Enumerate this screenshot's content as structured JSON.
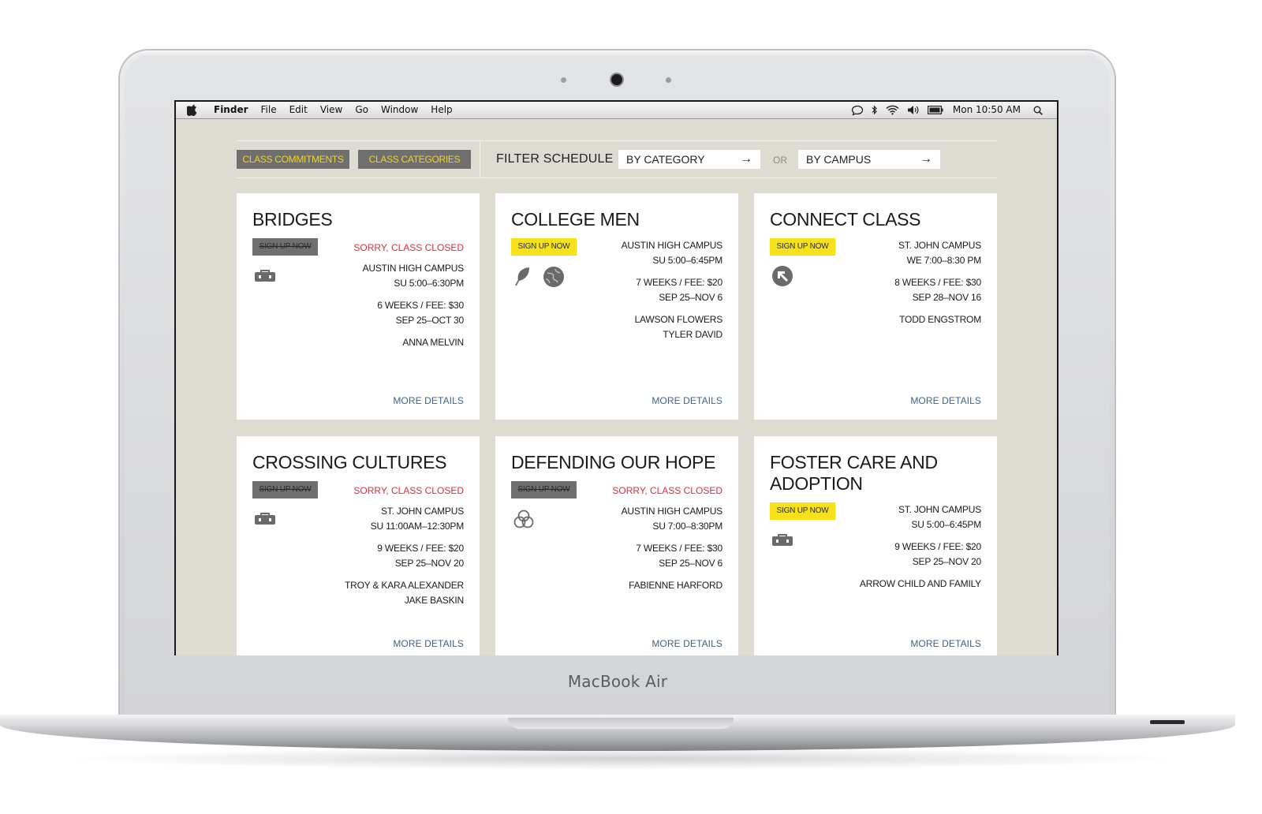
{
  "device": {
    "brand": "MacBook Air"
  },
  "menubar": {
    "app": "Finder",
    "items": [
      "File",
      "Edit",
      "View",
      "Go",
      "Window",
      "Help"
    ],
    "clock": "Mon 10:50 AM"
  },
  "toolbar": {
    "tab1": "CLASS COMMITMENTS",
    "tab2": "CLASS CATEGORIES",
    "filter_label": "FILTER SCHEDULE",
    "by_category": "BY CATEGORY",
    "or": "OR",
    "by_campus": "BY CAMPUS",
    "arrow": "→"
  },
  "cards": [
    {
      "title": "BRIDGES",
      "signup": "SIGN UP NOW",
      "closed": true,
      "closed_msg": "SORRY, CLASS CLOSED",
      "campus": "AUSTIN HIGH CAMPUS",
      "time": "SU 5:00–6:30PM",
      "weeks_fee": "6 WEEKS / FEE: $30",
      "dates": "SEP 25–OCT 30",
      "leaders": [
        "ANNA MELVIN"
      ],
      "icons": [
        "toolbox-icon"
      ],
      "more": "MORE DETAILS"
    },
    {
      "title": "COLLEGE MEN",
      "signup": "SIGN UP NOW",
      "closed": false,
      "closed_msg": "",
      "campus": "AUSTIN HIGH CAMPUS",
      "time": "SU 5:00–6:45PM",
      "weeks_fee": "7 WEEKS / FEE: $20",
      "dates": "SEP 25–NOV 6",
      "leaders": [
        "LAWSON FLOWERS",
        "TYLER DAVID"
      ],
      "icons": [
        "leaf-icon",
        "globe-icon"
      ],
      "more": "MORE DETAILS"
    },
    {
      "title": "CONNECT CLASS",
      "signup": "SIGN UP NOW",
      "closed": false,
      "closed_msg": "",
      "campus": "ST. JOHN CAMPUS",
      "time": "WE 7:00–8:30 PM",
      "weeks_fee": "8 WEEKS / FEE: $30",
      "dates": "SEP 28–NOV 16",
      "leaders": [
        "TODD ENGSTROM"
      ],
      "icons": [
        "direction-arrow-icon"
      ],
      "more": "MORE DETAILS"
    },
    {
      "title": "CROSSING CULTURES",
      "signup": "SIGN UP NOW",
      "closed": true,
      "closed_msg": "SORRY, CLASS CLOSED",
      "campus": "ST. JOHN CAMPUS",
      "time": "SU 11:00AM–12:30PM",
      "weeks_fee": "9 WEEKS / FEE: $20",
      "dates": "SEP 25–NOV 20",
      "leaders": [
        "TROY & KARA ALEXANDER",
        "JAKE BASKIN"
      ],
      "icons": [
        "toolbox-icon"
      ],
      "more": "MORE DETAILS"
    },
    {
      "title": "DEFENDING OUR HOPE",
      "signup": "SIGN UP NOW",
      "closed": true,
      "closed_msg": "SORRY, CLASS CLOSED",
      "campus": "AUSTIN HIGH CAMPUS",
      "time": "SU 7:00–8:30PM",
      "weeks_fee": "7 WEEKS / FEE: $30",
      "dates": "SEP 25–NOV 6",
      "leaders": [
        "FABIENNE HARFORD"
      ],
      "icons": [
        "trinity-knot-icon"
      ],
      "more": "MORE DETAILS"
    },
    {
      "title": "FOSTER CARE AND ADOPTION",
      "signup": "SIGN UP NOW",
      "closed": false,
      "closed_msg": "",
      "campus": "ST. JOHN CAMPUS",
      "time": "SU 5:00–6:45PM",
      "weeks_fee": "9 WEEKS / FEE: $20",
      "dates": "SEP 25–NOV 20",
      "leaders": [
        "ARROW CHILD AND FAMILY"
      ],
      "icons": [
        "toolbox-icon"
      ],
      "more": "MORE DETAILS"
    }
  ],
  "colors": {
    "page_background": "#dedcd2",
    "button_gray": "#6f6f6f",
    "button_text_yellow": "#f2d51f",
    "signup_yellow": "#f6e11a",
    "closed_red": "#d7303b",
    "link_blue": "#3f6386"
  }
}
